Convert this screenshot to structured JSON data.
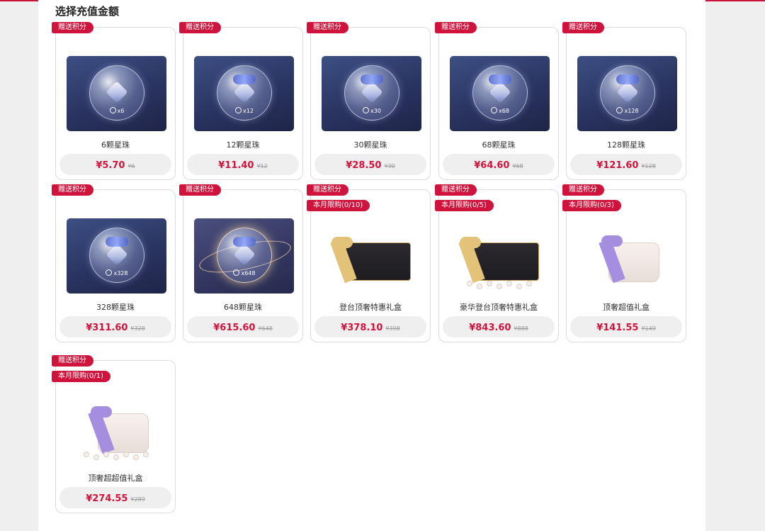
{
  "section_title": "选择充值金额",
  "bonus_tag": "赠送积分",
  "products": [
    {
      "name": "6颗星珠",
      "count": "x6",
      "price": "¥5.70",
      "original": "¥6",
      "limit": "",
      "art": "bubble"
    },
    {
      "name": "12颗星珠",
      "count": "x12",
      "price": "¥11.40",
      "original": "¥12",
      "limit": "",
      "art": "bubble"
    },
    {
      "name": "30颗星珠",
      "count": "x30",
      "price": "¥28.50",
      "original": "¥30",
      "limit": "",
      "art": "bubble"
    },
    {
      "name": "68颗星珠",
      "count": "x68",
      "price": "¥64.60",
      "original": "¥68",
      "limit": "",
      "art": "bubble"
    },
    {
      "name": "128颗星珠",
      "count": "x128",
      "price": "¥121.60",
      "original": "¥128",
      "limit": "",
      "art": "bubble"
    },
    {
      "name": "328颗星珠",
      "count": "x328",
      "price": "¥311.60",
      "original": "¥328",
      "limit": "",
      "art": "bubble"
    },
    {
      "name": "648颗星珠",
      "count": "x648",
      "price": "¥615.60",
      "original": "¥648",
      "limit": "",
      "art": "bubble-gold"
    },
    {
      "name": "登台顶奢特惠礼盒",
      "count": "",
      "price": "¥378.10",
      "original": "¥398",
      "limit": "本月限购(0/10)",
      "art": "dark-box"
    },
    {
      "name": "豪华登台顶奢特惠礼盒",
      "count": "",
      "price": "¥843.60",
      "original": "¥888",
      "limit": "本月限购(0/5)",
      "art": "dark-box-lux"
    },
    {
      "name": "顶奢超值礼盒",
      "count": "",
      "price": "¥141.55",
      "original": "¥149",
      "limit": "本月限购(0/3)",
      "art": "light-box"
    },
    {
      "name": "顶奢超超值礼盒",
      "count": "",
      "price": "¥274.55",
      "original": "¥289",
      "limit": "本月限购(0/1)",
      "art": "light-box-lux"
    }
  ]
}
